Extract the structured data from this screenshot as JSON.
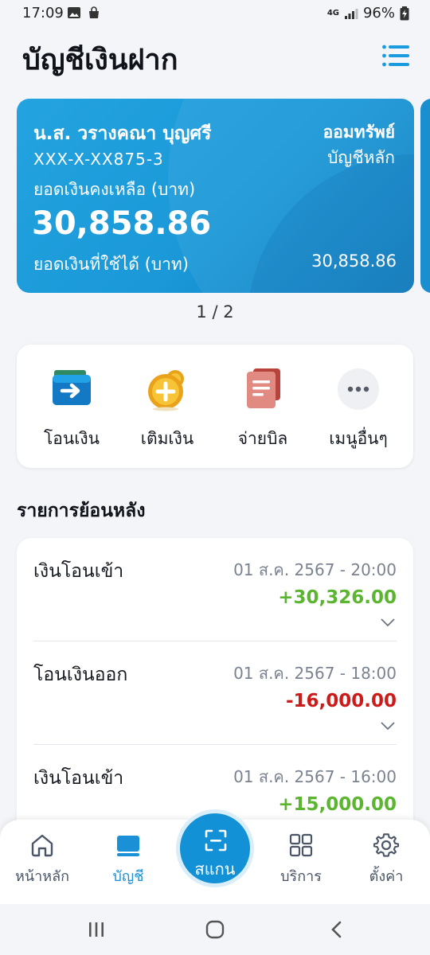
{
  "status_bar": {
    "time": "17:09",
    "battery": "96%",
    "network": "4G"
  },
  "header": {
    "title": "บัญชีเงินฝาก"
  },
  "account": {
    "holder_name": "น.ส. วรางคณา บุญศรี",
    "account_type": "ออมทรัพย์",
    "account_number": "XXX-X-XX875-3",
    "main_account_label": "บัญชีหลัก",
    "balance_label": "ยอดเงินคงเหลือ (บาท)",
    "balance": "30,858.86",
    "available_label": "ยอดเงินที่ใช้ได้ (บาท)",
    "available": "30,858.86"
  },
  "pager": "1 / 2",
  "quick_actions": [
    {
      "label": "โอนเงิน",
      "icon": "transfer-icon"
    },
    {
      "label": "เติมเงิน",
      "icon": "topup-icon"
    },
    {
      "label": "จ่ายบิล",
      "icon": "bill-icon"
    },
    {
      "label": "เมนูอื่นๆ",
      "icon": "more-icon"
    }
  ],
  "history": {
    "title": "รายการย้อนหลัง",
    "items": [
      {
        "title": "เงินโอนเข้า",
        "datetime": "01 ส.ค. 2567 - 20:00",
        "amount": "+30,326.00",
        "direction": "in"
      },
      {
        "title": "โอนเงินออก",
        "datetime": "01 ส.ค. 2567 - 18:00",
        "amount": "-16,000.00",
        "direction": "out"
      },
      {
        "title": "เงินโอนเข้า",
        "datetime": "01 ส.ค. 2567 - 16:00",
        "amount": "+15,000.00",
        "direction": "in"
      }
    ]
  },
  "bottom_nav": {
    "items": [
      {
        "label": "หน้าหลัก",
        "icon": "home-icon"
      },
      {
        "label": "บัญชี",
        "icon": "account-icon"
      },
      {
        "label": "บริการ",
        "icon": "services-grid-icon"
      },
      {
        "label": "ตั้งค่า",
        "icon": "settings-gear-icon"
      }
    ],
    "scan_label": "สแกน"
  },
  "colors": {
    "accent": "#1a98d8",
    "positive": "#5cb531",
    "negative": "#cc1b1b"
  }
}
